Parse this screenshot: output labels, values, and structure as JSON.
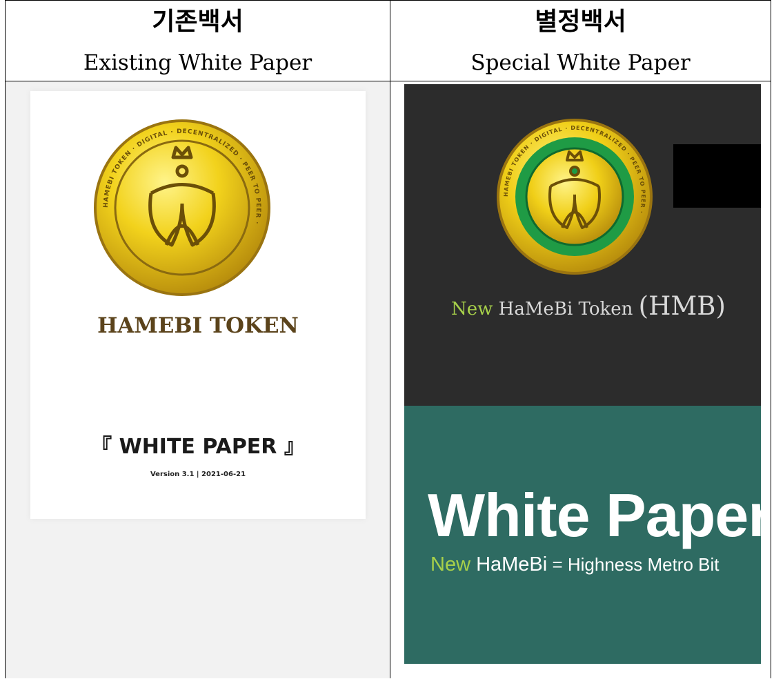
{
  "headers": {
    "left_ko": "기존백서",
    "left_en": "Existing White Paper",
    "right_ko": "별정백서",
    "right_en": "Special White Paper"
  },
  "left_doc": {
    "token": "HAMEBI TOKEN",
    "white_paper": "『 WHITE PAPER 』",
    "version": "Version 3.1  |  2021-06-21",
    "coin_ring_text": "HAMEBI TOKEN · DIGITAL · DECENTRALIZED · PEER TO PEER ·"
  },
  "right_doc": {
    "token_new": "New",
    "token_name": " HaMeBi Token ",
    "token_symbol": "(HMB)",
    "big_title": "White Paper",
    "sub_new": "New",
    "sub_hamebi": " HaMeBi",
    "sub_rest": " = Highness Metro Bit",
    "coin_ring_text": "HAMEBI TOKEN · DIGITAL · DECENTRALIZED · PEER TO PEER ·"
  },
  "colors": {
    "gold": "#e8c21a",
    "gold_dark": "#8a6a10",
    "ring_green": "#1f9b45",
    "dark_bg": "#2c2c2c",
    "teal_bg": "#2e6b62",
    "accent_green": "#a7d04a",
    "brown_text": "#5b431b"
  }
}
